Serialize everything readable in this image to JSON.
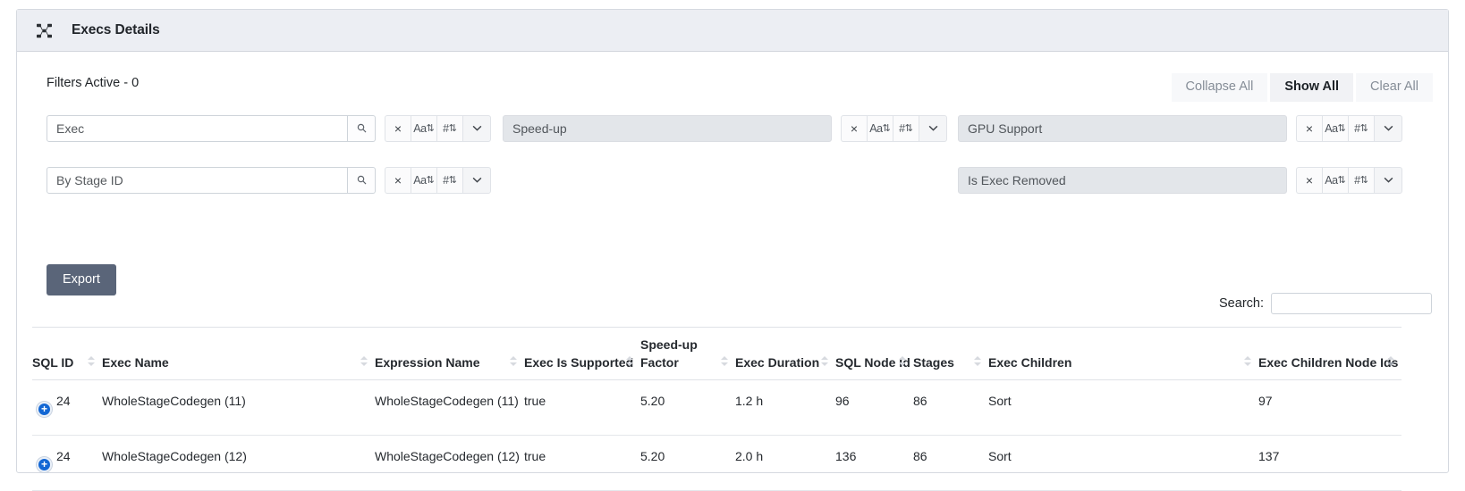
{
  "panel": {
    "title": "Execs Details",
    "icon": "project-diagram-icon"
  },
  "filters": {
    "active_label": "Filters Active - 0",
    "top_buttons": [
      {
        "label": "Collapse All",
        "active": false
      },
      {
        "label": "Show All",
        "active": true
      },
      {
        "label": "Clear All",
        "active": false
      }
    ],
    "action_icons": {
      "clear": "×",
      "sort_alpha": "Aa",
      "sort_numeric": "#",
      "updown": "⇅",
      "chevron": "⌄",
      "search_icon": "magnifier-icon"
    },
    "controls": [
      {
        "placeholder": "Exec",
        "value": "",
        "type": "search",
        "row": 1,
        "col": 1
      },
      {
        "placeholder": "Speed-up",
        "value": "",
        "type": "plain",
        "row": 1,
        "col": 2
      },
      {
        "placeholder": "GPU Support",
        "value": "",
        "type": "plain",
        "row": 1,
        "col": 3
      },
      {
        "placeholder": "By Stage ID",
        "value": "",
        "type": "search",
        "row": 2,
        "col": 1
      },
      {
        "placeholder": "Is Exec Removed",
        "value": "",
        "type": "plain",
        "row": 2,
        "col": 3
      }
    ]
  },
  "export": {
    "label": "Export"
  },
  "table_search": {
    "label": "Search:",
    "value": "",
    "placeholder": ""
  },
  "table": {
    "columns": [
      {
        "label": "SQL ID",
        "sortable": true,
        "sorted": "none"
      },
      {
        "label": "Exec Name",
        "sortable": true,
        "sorted": "none"
      },
      {
        "label": "Expression Name",
        "sortable": true,
        "sorted": "none"
      },
      {
        "label": "Exec Is Supported",
        "sortable": true,
        "sorted": "none"
      },
      {
        "label": "Speed-up Factor",
        "sortable": true,
        "sorted": "none"
      },
      {
        "label": "Exec Duration",
        "sortable": true,
        "sorted": "none"
      },
      {
        "label": "SQL Node Id",
        "sortable": true,
        "sorted": "none"
      },
      {
        "label": "Stages",
        "sortable": true,
        "sorted": "none"
      },
      {
        "label": "Exec Children",
        "sortable": true,
        "sorted": "none"
      },
      {
        "label": "Exec Children Node Ids",
        "sortable": true,
        "sorted": "desc"
      }
    ],
    "rows": [
      {
        "expand": "+",
        "sql_id": "24",
        "exec_name": "WholeStageCodegen (11)",
        "expression_name": "WholeStageCodegen (11)",
        "exec_is_supported": "true",
        "speedup_factor": "5.20",
        "exec_duration": "1.2 h",
        "sql_node_id": "96",
        "stages": "86",
        "exec_children": "Sort",
        "exec_children_node_ids": "97"
      },
      {
        "expand": "+",
        "sql_id": "24",
        "exec_name": "WholeStageCodegen (12)",
        "expression_name": "WholeStageCodegen (12)",
        "exec_is_supported": "true",
        "speedup_factor": "5.20",
        "exec_duration": "2.0 h",
        "sql_node_id": "136",
        "stages": "86",
        "exec_children": "Sort",
        "exec_children_node_ids": "137"
      }
    ]
  },
  "colors": {
    "header_bg": "#eceef3",
    "export_bg": "#5a6579",
    "expand_icon": "#1367d4",
    "disabled_field_bg": "#e3e6ea",
    "border": "#d5d9e0"
  }
}
